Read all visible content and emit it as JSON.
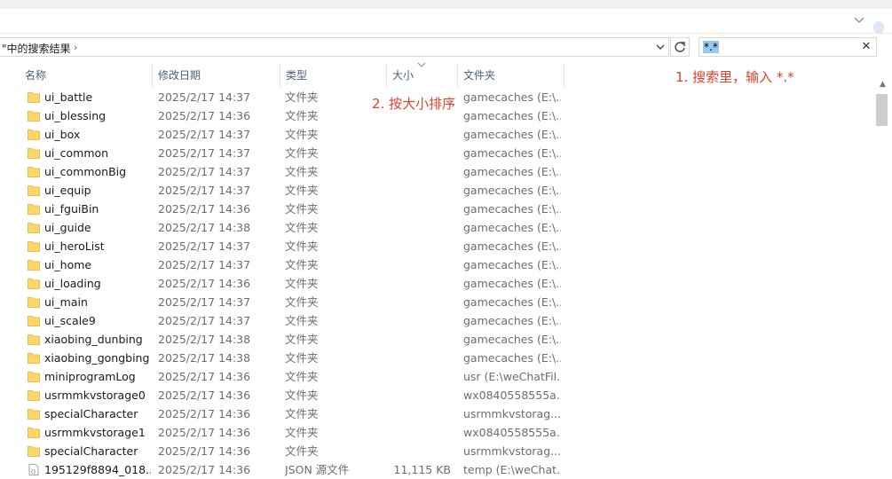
{
  "address": {
    "breadcrumb": "\"中的搜索结果",
    "chevron": "›"
  },
  "search": {
    "value": "*.*",
    "clear": "✕"
  },
  "columns": {
    "name": "名称",
    "date": "修改日期",
    "type": "类型",
    "size": "大小",
    "folder": "文件夹"
  },
  "annotations": {
    "step1": "1. 搜索里，输入 *.*",
    "step2": "2. 按大小排序"
  },
  "rows": [
    {
      "name": "ui_battle",
      "date": "2025/2/17 14:37",
      "type": "文件夹",
      "size": "",
      "folder": "gamecaches (E:\\...",
      "icon": "folder-icon"
    },
    {
      "name": "ui_blessing",
      "date": "2025/2/17 14:36",
      "type": "文件夹",
      "size": "",
      "folder": "gamecaches (E:\\...",
      "icon": "folder-icon"
    },
    {
      "name": "ui_box",
      "date": "2025/2/17 14:37",
      "type": "文件夹",
      "size": "",
      "folder": "gamecaches (E:\\...",
      "icon": "folder-icon"
    },
    {
      "name": "ui_common",
      "date": "2025/2/17 14:37",
      "type": "文件夹",
      "size": "",
      "folder": "gamecaches (E:\\...",
      "icon": "folder-icon"
    },
    {
      "name": "ui_commonBig",
      "date": "2025/2/17 14:37",
      "type": "文件夹",
      "size": "",
      "folder": "gamecaches (E:\\...",
      "icon": "folder-icon"
    },
    {
      "name": "ui_equip",
      "date": "2025/2/17 14:37",
      "type": "文件夹",
      "size": "",
      "folder": "gamecaches (E:\\...",
      "icon": "folder-icon"
    },
    {
      "name": "ui_fguiBin",
      "date": "2025/2/17 14:36",
      "type": "文件夹",
      "size": "",
      "folder": "gamecaches (E:\\...",
      "icon": "folder-icon"
    },
    {
      "name": "ui_guide",
      "date": "2025/2/17 14:38",
      "type": "文件夹",
      "size": "",
      "folder": "gamecaches (E:\\...",
      "icon": "folder-icon"
    },
    {
      "name": "ui_heroList",
      "date": "2025/2/17 14:37",
      "type": "文件夹",
      "size": "",
      "folder": "gamecaches (E:\\...",
      "icon": "folder-icon"
    },
    {
      "name": "ui_home",
      "date": "2025/2/17 14:37",
      "type": "文件夹",
      "size": "",
      "folder": "gamecaches (E:\\...",
      "icon": "folder-icon"
    },
    {
      "name": "ui_loading",
      "date": "2025/2/17 14:36",
      "type": "文件夹",
      "size": "",
      "folder": "gamecaches (E:\\...",
      "icon": "folder-icon"
    },
    {
      "name": "ui_main",
      "date": "2025/2/17 14:37",
      "type": "文件夹",
      "size": "",
      "folder": "gamecaches (E:\\...",
      "icon": "folder-icon"
    },
    {
      "name": "ui_scale9",
      "date": "2025/2/17 14:37",
      "type": "文件夹",
      "size": "",
      "folder": "gamecaches (E:\\...",
      "icon": "folder-icon"
    },
    {
      "name": "xiaobing_dunbing",
      "date": "2025/2/17 14:38",
      "type": "文件夹",
      "size": "",
      "folder": "gamecaches (E:\\...",
      "icon": "folder-icon"
    },
    {
      "name": "xiaobing_gongbing",
      "date": "2025/2/17 14:38",
      "type": "文件夹",
      "size": "",
      "folder": "gamecaches (E:\\...",
      "icon": "folder-icon"
    },
    {
      "name": "miniprogramLog",
      "date": "2025/2/17 14:36",
      "type": "文件夹",
      "size": "",
      "folder": "usr (E:\\weChatFil...",
      "icon": "folder-icon"
    },
    {
      "name": "usrmmkvstorage0",
      "date": "2025/2/17 14:36",
      "type": "文件夹",
      "size": "",
      "folder": "wx0840558555a...",
      "icon": "folder-icon"
    },
    {
      "name": "specialCharacter",
      "date": "2025/2/17 14:36",
      "type": "文件夹",
      "size": "",
      "folder": "usrmmkvstorag...",
      "icon": "folder-icon"
    },
    {
      "name": "usrmmkvstorage1",
      "date": "2025/2/17 14:36",
      "type": "文件夹",
      "size": "",
      "folder": "wx0840558555a...",
      "icon": "folder-icon"
    },
    {
      "name": "specialCharacter",
      "date": "2025/2/17 14:36",
      "type": "文件夹",
      "size": "",
      "folder": "usrmmkvstorag...",
      "icon": "folder-icon"
    },
    {
      "name": "195129f8894_018....",
      "date": "2025/2/17 14:36",
      "type": "JSON 源文件",
      "size": "11,115 KB",
      "folder": "temp (E:\\weChat...",
      "icon": "json-file-icon"
    }
  ]
}
